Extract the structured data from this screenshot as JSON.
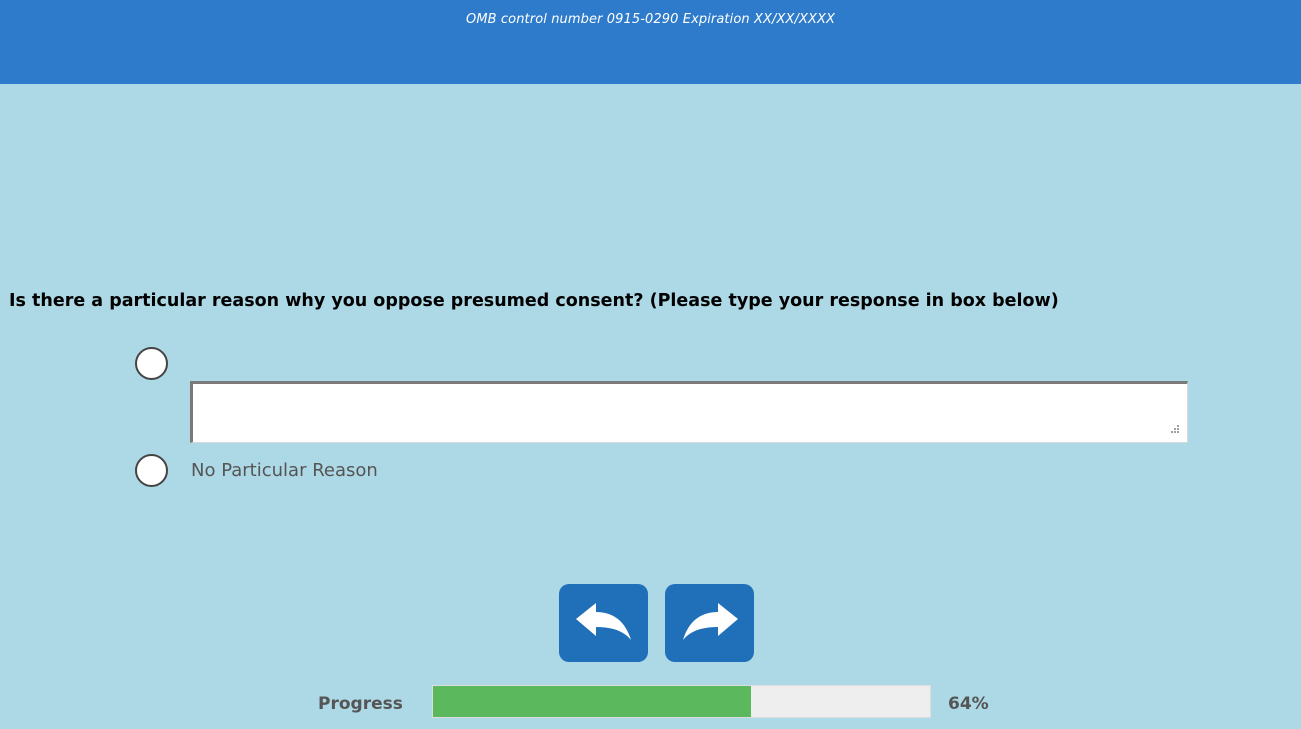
{
  "header": {
    "omb_text": "OMB control number 0915-0290 Expiration XX/XX/XXXX",
    "bg_color": "#2f7bcb"
  },
  "question": {
    "text": "Is there a particular reason why you oppose presumed consent? (Please type your response in box below)"
  },
  "options": [
    {
      "label": "",
      "type": "radio-with-text",
      "selected": false,
      "text_value": ""
    },
    {
      "label": "No Particular Reason",
      "type": "radio",
      "selected": false
    }
  ],
  "navigation": {
    "back_icon": "back-arrow-icon",
    "next_icon": "forward-arrow-icon",
    "button_color": "#1f70b8"
  },
  "progress": {
    "label": "Progress",
    "value": 64,
    "display": "64%",
    "fill_color": "#5cb85c"
  },
  "colors": {
    "page_bg": "#add8e6"
  }
}
